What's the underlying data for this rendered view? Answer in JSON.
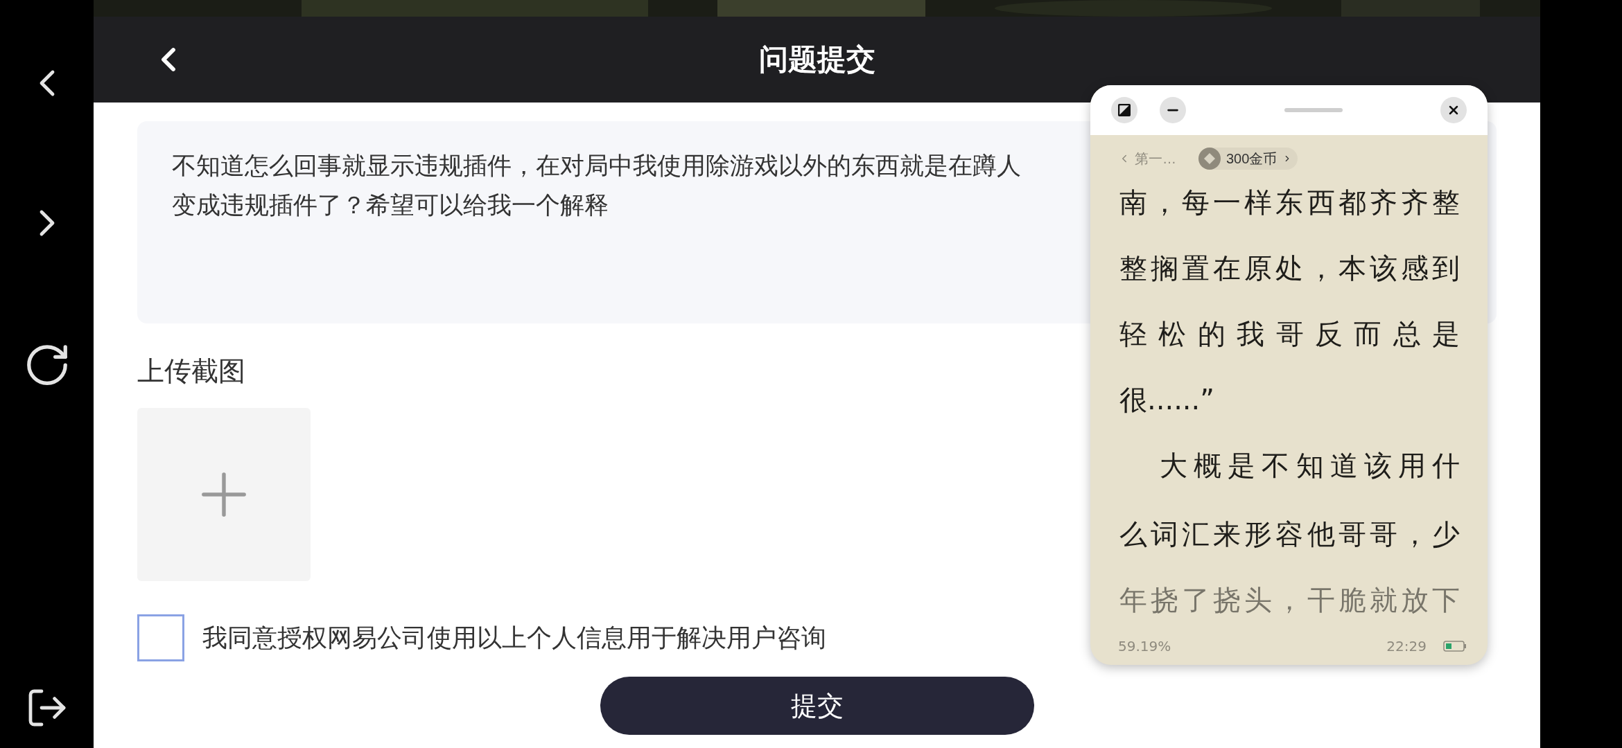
{
  "header": {
    "title": "问题提交"
  },
  "description": {
    "lines": [
      "不知道怎么回事就显示违规插件，在对局中我使用除游戏以外的东西就是在蹲人",
      "变成违规插件了？希望可以给我一个解释"
    ]
  },
  "upload": {
    "label": "上传截图"
  },
  "consent": {
    "label": "我同意授权网易公司使用以上个人信息用于解决用户咨询",
    "checked": false
  },
  "submit": {
    "label": "提交"
  },
  "reader": {
    "chapter": "第一…",
    "coins": "300金币",
    "lines": [
      {
        "text": "南，每一样东西都齐齐整",
        "kind": "full"
      },
      {
        "text": "整搁置在原处，本该感到",
        "kind": "full"
      },
      {
        "text": "轻松的我哥反而总是",
        "kind": "full"
      },
      {
        "text": "很......”",
        "kind": "end"
      },
      {
        "text": "大概是不知道该用什",
        "kind": "indent"
      },
      {
        "text": "么词汇来形容他哥哥，少",
        "kind": "full"
      },
      {
        "text": "年挠了挠头，干脆就放下",
        "kind": "full"
      }
    ],
    "progress": "59.19%",
    "time": "22:29"
  }
}
